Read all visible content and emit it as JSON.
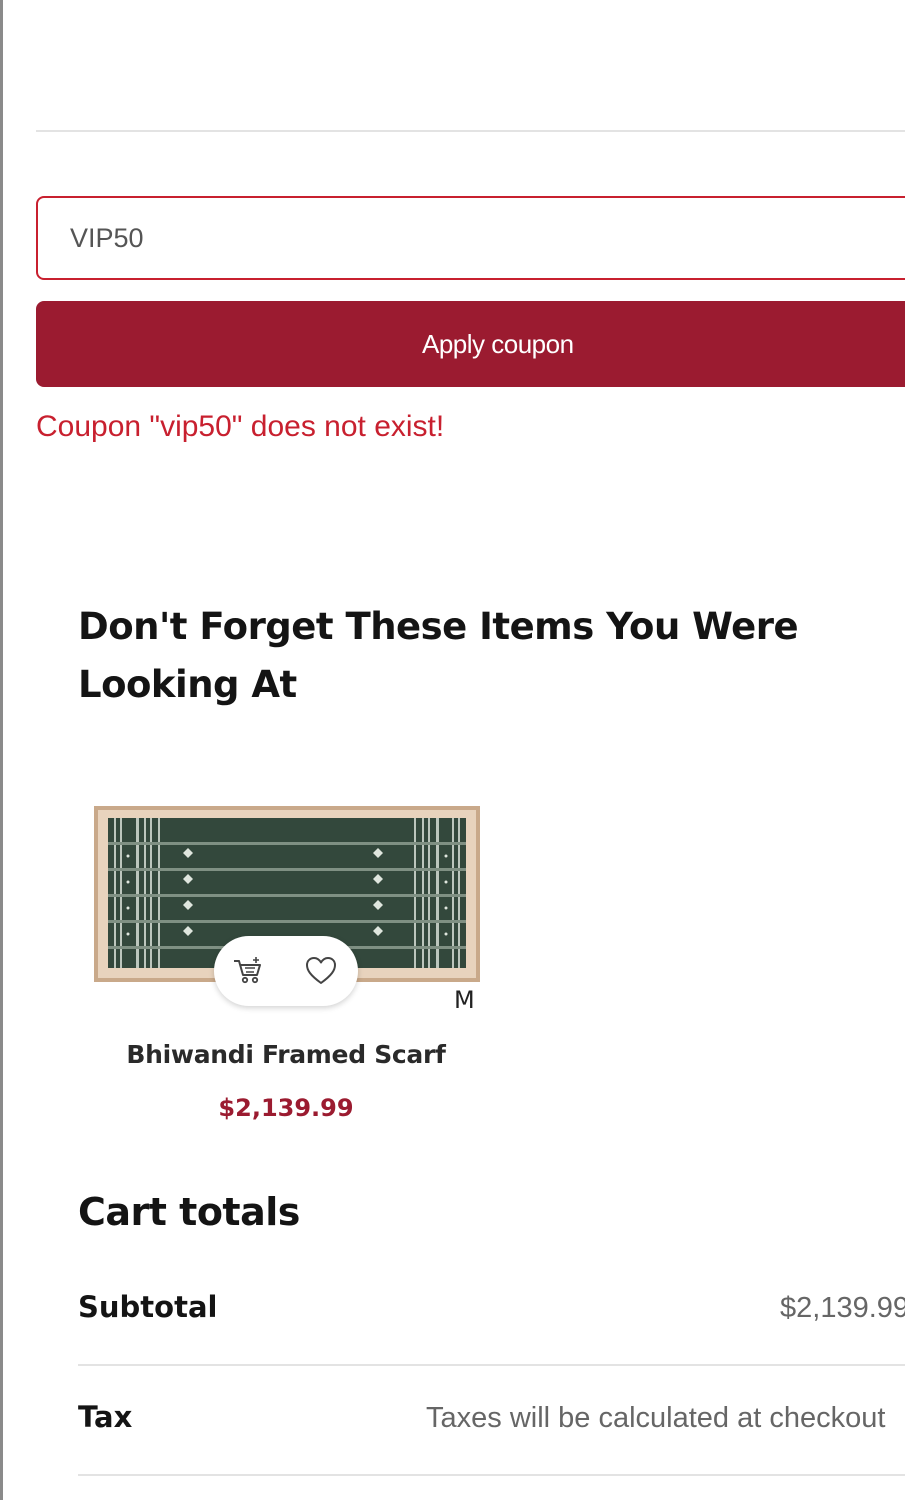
{
  "coupon": {
    "input_value": "VIP50",
    "apply_label": "Apply coupon",
    "error_message": "Coupon \"vip50\" does not exist!"
  },
  "recently_viewed": {
    "heading": "Don't Forget These Items You Were Looking At",
    "products": [
      {
        "name": "Bhiwandi Framed Scarf",
        "price": "$2,139.99",
        "brand_mark": "M",
        "actions": [
          "cart-icon",
          "heart-icon"
        ]
      }
    ]
  },
  "cart_totals": {
    "heading": "Cart totals",
    "rows": [
      {
        "label": "Subtotal",
        "value": "$2,139.99"
      },
      {
        "label": "Tax",
        "value": "Taxes will be calculated at checkout"
      }
    ]
  },
  "colors": {
    "accent": "#9b1b30",
    "error": "#c8202f",
    "divider": "#e3e3e3"
  }
}
